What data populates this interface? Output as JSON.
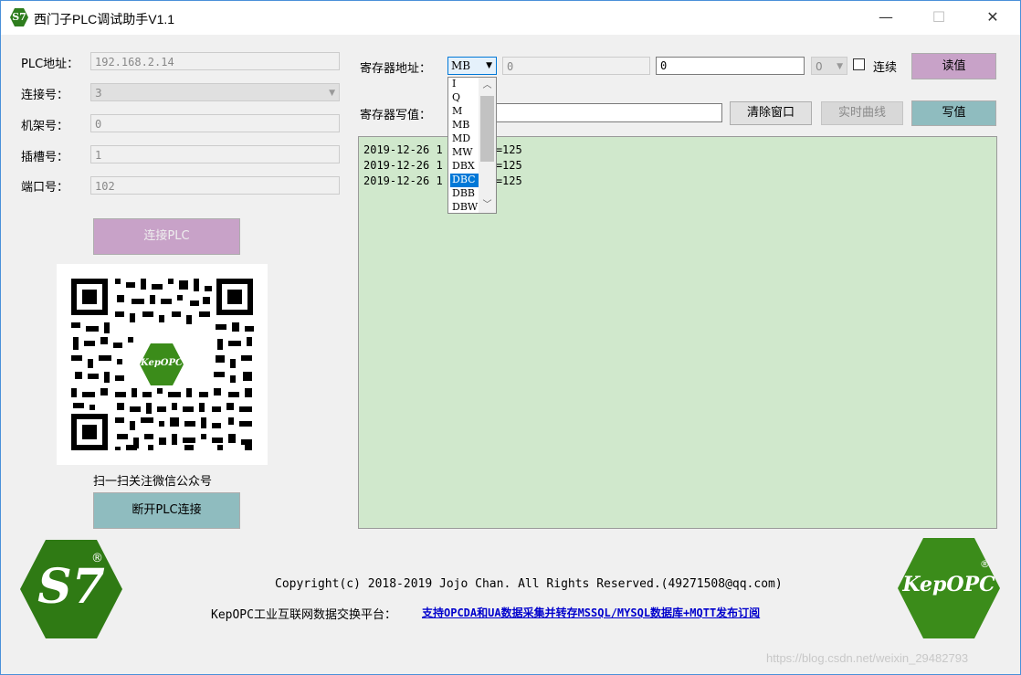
{
  "window": {
    "title": "西门子PLC调试助手V1.1",
    "app_icon_text": "S7",
    "minimize": "—",
    "maximize": "☐",
    "close": "✕"
  },
  "connection": {
    "plc_address_label": "PLC地址：",
    "plc_address_value": "192.168.2.14",
    "connection_no_label": "连接号：",
    "connection_no_value": "3",
    "rack_label": "机架号：",
    "rack_value": "0",
    "slot_label": "插槽号：",
    "slot_value": "1",
    "port_label": "端口号：",
    "port_value": "102",
    "connect_button": "连接PLC",
    "disconnect_button": "断开PLC连接",
    "qr_caption": "扫一扫关注微信公众号",
    "qr_logo": "KepOPC"
  },
  "register": {
    "address_label": "寄存器地址：",
    "type_selected": "MB",
    "offset_value": "0",
    "address_value": "0",
    "bit_value": "0",
    "continuous_label": "连续",
    "read_button": "读值",
    "write_label": "寄存器写值：",
    "write_value": "",
    "clear_button": "清除窗口",
    "curve_button": "实时曲线",
    "write_button": "写值",
    "dropdown_options": [
      "I",
      "Q",
      "M",
      "MB",
      "MD",
      "MW",
      "DBX",
      "DBC",
      "DBB",
      "DBW"
    ],
    "dropdown_highlighted": "DBC"
  },
  "log": {
    "lines": [
      {
        "date": "2019-12-26 1",
        "rest": "1  MB0=125"
      },
      {
        "date": "2019-12-26 1",
        "rest": "1  MB0=125"
      },
      {
        "date": "2019-12-26 1",
        "rest": "1  MB0=125"
      }
    ]
  },
  "footer": {
    "copyright": "Copyright(c) 2018-2019 Jojo Chan. All Rights Reserved.(49271508@qq.com)",
    "platform_label": "KepOPC工业互联网数据交换平台：",
    "platform_link": "支持OPCDA和UA数据采集并转存MSSQL/MYSQL数据库+MQTT发布订阅",
    "s7_logo_text": "S7",
    "kepopc_logo_text": "KepOPC",
    "registered_mark": "®",
    "watermark": "https://blog.csdn.net/weixin_29482793"
  },
  "colors": {
    "read_button": "#c8a2c8",
    "write_button": "#8fbcbf",
    "log_background": "#d0e8cc",
    "logo_green": "#3b8c1a"
  }
}
